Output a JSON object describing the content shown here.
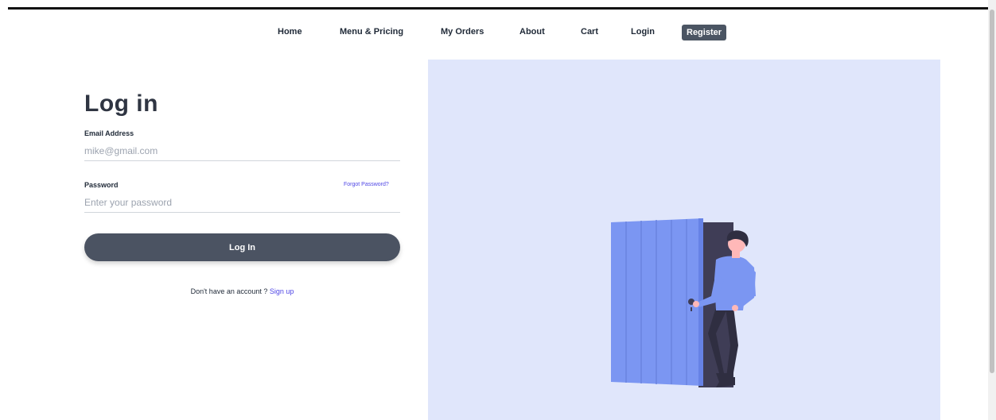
{
  "nav": {
    "items": [
      {
        "label": "Home"
      },
      {
        "label": "Menu & Pricing"
      },
      {
        "label": "My Orders"
      },
      {
        "label": "About"
      },
      {
        "label": "Cart"
      },
      {
        "label": "Login"
      }
    ],
    "register_label": "Register"
  },
  "form": {
    "title": "Log in",
    "email": {
      "label": "Email Address",
      "placeholder": "mike@gmail.com",
      "value": ""
    },
    "password": {
      "label": "Password",
      "placeholder": "Enter your password",
      "value": "",
      "forgot_label": "Forgot Password?"
    },
    "submit_label": "Log In",
    "signup_prompt": "Don't have an account ?",
    "signup_link": "Sign up"
  },
  "illustration": {
    "background": "#e0e6fb",
    "door_color": "#7b96f2",
    "person_shirt_color": "#7b96f2"
  },
  "colors": {
    "accent": "#4f46e5",
    "button": "#4b5362",
    "text": "#1f2937"
  }
}
